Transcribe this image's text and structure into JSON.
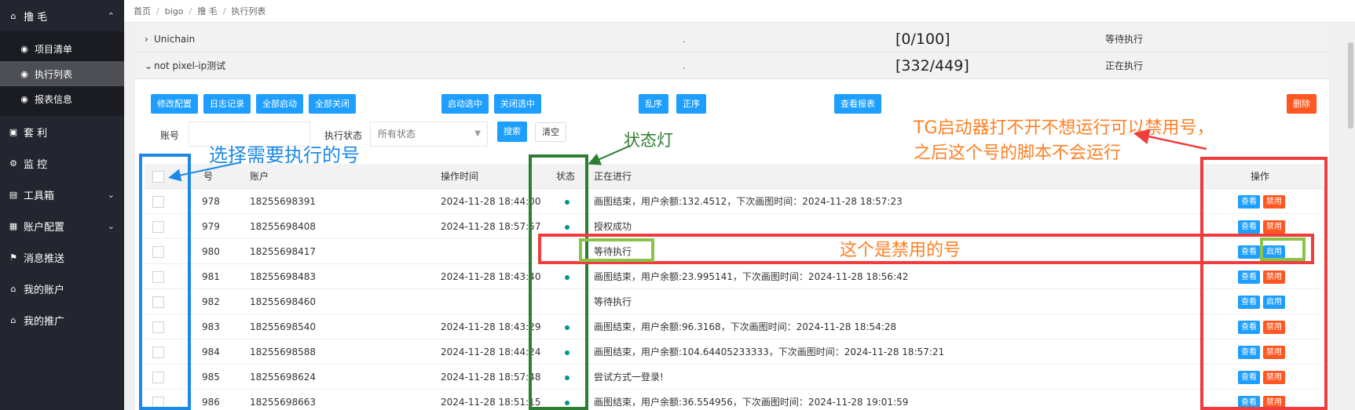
{
  "sidebar": {
    "top": {
      "icon": "home-icon",
      "label": "撸 毛"
    },
    "sub": [
      {
        "icon": "dashboard-icon",
        "label": "项目清单"
      },
      {
        "icon": "dashboard-icon",
        "label": "执行列表"
      },
      {
        "icon": "dashboard-icon",
        "label": "报表信息"
      }
    ],
    "items": [
      {
        "icon": "card-icon",
        "label": "套 利"
      },
      {
        "icon": "monitor-icon",
        "label": "监 控"
      },
      {
        "icon": "file-icon",
        "label": "工具箱"
      },
      {
        "icon": "calendar-icon",
        "label": "账户配置"
      },
      {
        "icon": "flag-icon",
        "label": "消息推送"
      },
      {
        "icon": "home-icon",
        "label": "我的账户"
      },
      {
        "icon": "home-icon",
        "label": "我的推广"
      }
    ]
  },
  "breadcrumb": [
    "首页",
    "bigo",
    "撸 毛",
    "执行列表"
  ],
  "groups": [
    {
      "name": "Unichain",
      "dot": ".",
      "count": "[0/100]",
      "status": "等待执行"
    },
    {
      "name": "not pixel-ip测试",
      "dot": ".",
      "count": "[332/449]",
      "status": "正在执行"
    }
  ],
  "toolbar": {
    "edit": "修改配置",
    "log": "日志记录",
    "start_all": "全部启动",
    "stop_all": "全部关闭",
    "start_sel": "启动选中",
    "stop_sel": "关闭选中",
    "shuffle": "乱序",
    "order": "正序",
    "report": "查看报表",
    "delete": "删除"
  },
  "filter": {
    "account_label": "账号",
    "status_label": "执行状态",
    "status_value": "所有状态",
    "search": "搜索",
    "clear": "清空"
  },
  "table": {
    "headers": {
      "no": "号",
      "account": "账户",
      "time": "操作时间",
      "status": "状态",
      "progress": "正在进行",
      "actions": "操作"
    },
    "view_label": "查看",
    "rows": [
      {
        "no": "978",
        "account": "18255698391",
        "time": "2024-11-28 18:44:00",
        "active": true,
        "progress": "画图结束，用户余额:132.4512，下次画图时间：2024-11-28 18:57:23",
        "toggle": "禁用"
      },
      {
        "no": "979",
        "account": "18255698408",
        "time": "2024-11-28 18:57:57",
        "active": true,
        "progress": "授权成功",
        "toggle": "禁用"
      },
      {
        "no": "980",
        "account": "18255698417",
        "time": "",
        "active": false,
        "progress": "等待执行",
        "toggle": "启用"
      },
      {
        "no": "981",
        "account": "18255698483",
        "time": "2024-11-28 18:43:40",
        "active": true,
        "progress": "画图结束，用户余额:23.995141，下次画图时间：2024-11-28 18:56:42",
        "toggle": "禁用"
      },
      {
        "no": "982",
        "account": "18255698460",
        "time": "",
        "active": false,
        "progress": "等待执行",
        "toggle": "启用"
      },
      {
        "no": "983",
        "account": "18255698540",
        "time": "2024-11-28 18:43:29",
        "active": true,
        "progress": "画图结束，用户余额:96.3168，下次画图时间：2024-11-28 18:54:28",
        "toggle": "禁用"
      },
      {
        "no": "984",
        "account": "18255698588",
        "time": "2024-11-28 18:44:24",
        "active": true,
        "progress": "画图结束，用户余额:104.64405233333，下次画图时间：2024-11-28 18:57:21",
        "toggle": "禁用"
      },
      {
        "no": "985",
        "account": "18255698624",
        "time": "2024-11-28 18:57:48",
        "active": true,
        "progress": "尝试方式一登录!",
        "toggle": "禁用"
      },
      {
        "no": "986",
        "account": "18255698663",
        "time": "2024-11-28 18:51:15",
        "active": true,
        "progress": "画图结束，用户余额:36.554956，下次画图时间：2024-11-28 19:01:59",
        "toggle": "禁用"
      }
    ]
  },
  "annotations": {
    "select_hint": "选择需要执行的号",
    "status_light": "状态灯",
    "tg_hint_line1": "TG启动器打不开不想运行可以禁用号，",
    "tg_hint_line2": "之后这个号的脚本不会运行",
    "disabled_hint": "这个是禁用的号",
    "colors": {
      "blue": "#1e88e5",
      "green": "#2e7d32",
      "orange": "#ff7f24",
      "red": "#f03c3c",
      "lime": "#8bc34a"
    }
  }
}
